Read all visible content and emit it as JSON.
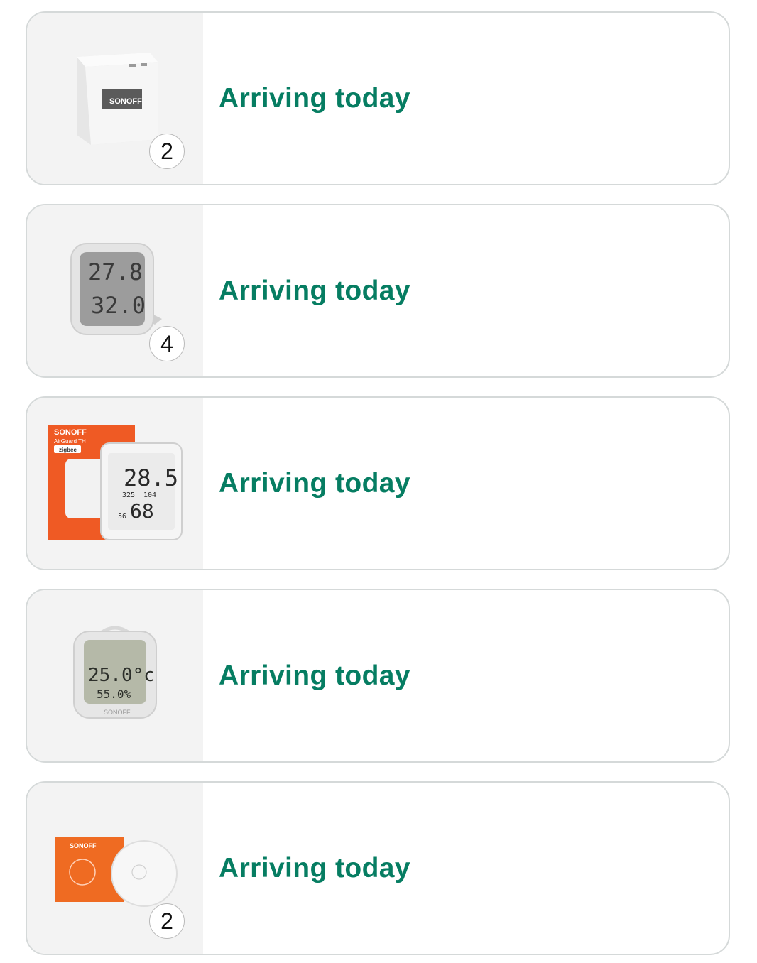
{
  "orders": [
    {
      "status": "Arriving today",
      "quantity": "2",
      "product_image": "sonoff-zigbee-bridge",
      "brand": "SONOFF"
    },
    {
      "status": "Arriving today",
      "quantity": "4",
      "product_image": "temperature-humidity-sensor-standing",
      "display": {
        "temp": "27.8",
        "humidity": "32.0"
      }
    },
    {
      "status": "Arriving today",
      "quantity": null,
      "product_image": "sonoff-airguard-th-box-and-device",
      "brand": "SONOFF",
      "product_line": "AirGuard TH",
      "protocol": "zigbee",
      "display": {
        "temp": "28.5",
        "humidity": "68",
        "sub1": "325",
        "sub2": "104",
        "sub3": "56"
      }
    },
    {
      "status": "Arriving today",
      "quantity": null,
      "product_image": "hanging-lcd-thermometer",
      "brand": "SONOFF",
      "display": {
        "temp": "25.0°c",
        "humidity": "55.0%"
      }
    },
    {
      "status": "Arriving today",
      "quantity": "2",
      "product_image": "round-zigbee-temperature-sensor-box",
      "brand": "SONOFF"
    }
  ],
  "colors": {
    "status_green": "#067d62",
    "card_border": "#d5d9d9",
    "thumb_bg": "#f3f3f3",
    "box_orange": "#ef5a24"
  }
}
